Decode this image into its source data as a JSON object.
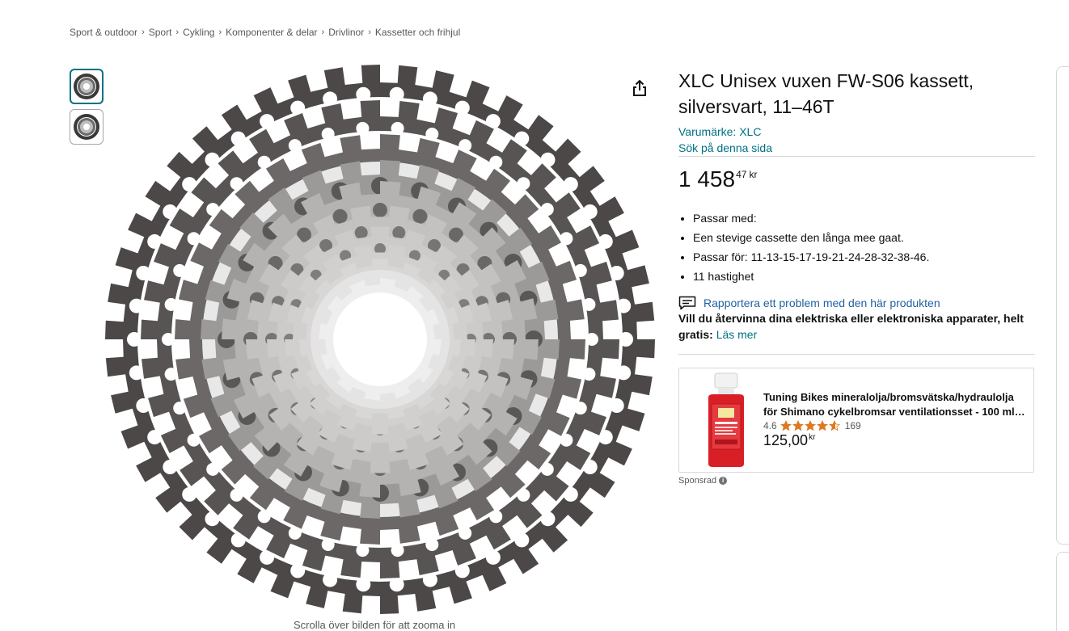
{
  "breadcrumb": [
    "Sport & outdoor",
    "Sport",
    "Cykling",
    "Komponenter & delar",
    "Drivlinor",
    "Kassetter och frihjul"
  ],
  "product": {
    "title": "XLC Unisex vuxen FW-S06 kassett, silversvart, 11–46T",
    "brand_link": "Varumärke: XLC",
    "search_link": "Sök på denna sida",
    "price_whole": "1 458",
    "price_fraction": "47",
    "price_currency": "kr",
    "bullets": [
      "Passar med:",
      "Een stevige cassette den långa mee gaat.",
      "Passar för: 11-13-15-17-19-21-24-28-32-38-46.",
      "11 hastighet"
    ],
    "report_link": "Rapportera ett problem med den här produkten",
    "recycle_text": "Vill du återvinna dina elektriska eller elektroniska apparater, helt gratis",
    "recycle_colon": ":",
    "recycle_link": "Läs mer"
  },
  "image": {
    "zoom_hint": "Scrolla över bilden för att zooma in"
  },
  "sponsored": {
    "title": "Tuning Bikes mineralolja/bromsvätska/hydraulolja för Shimano cykelbromsar ventilationsset - 100 ml…",
    "rating": "4.6",
    "rating_value": 4.6,
    "review_count": "169",
    "price_whole": "125,00",
    "price_currency": "kr",
    "label": "Sponsrad"
  },
  "colors": {
    "link": "#007185",
    "report_link": "#2162a1",
    "star": "#de7921",
    "thumb_active_border": "#007185"
  },
  "icons": {
    "share": "share-icon",
    "report": "comment-icon",
    "info": "info-icon"
  }
}
